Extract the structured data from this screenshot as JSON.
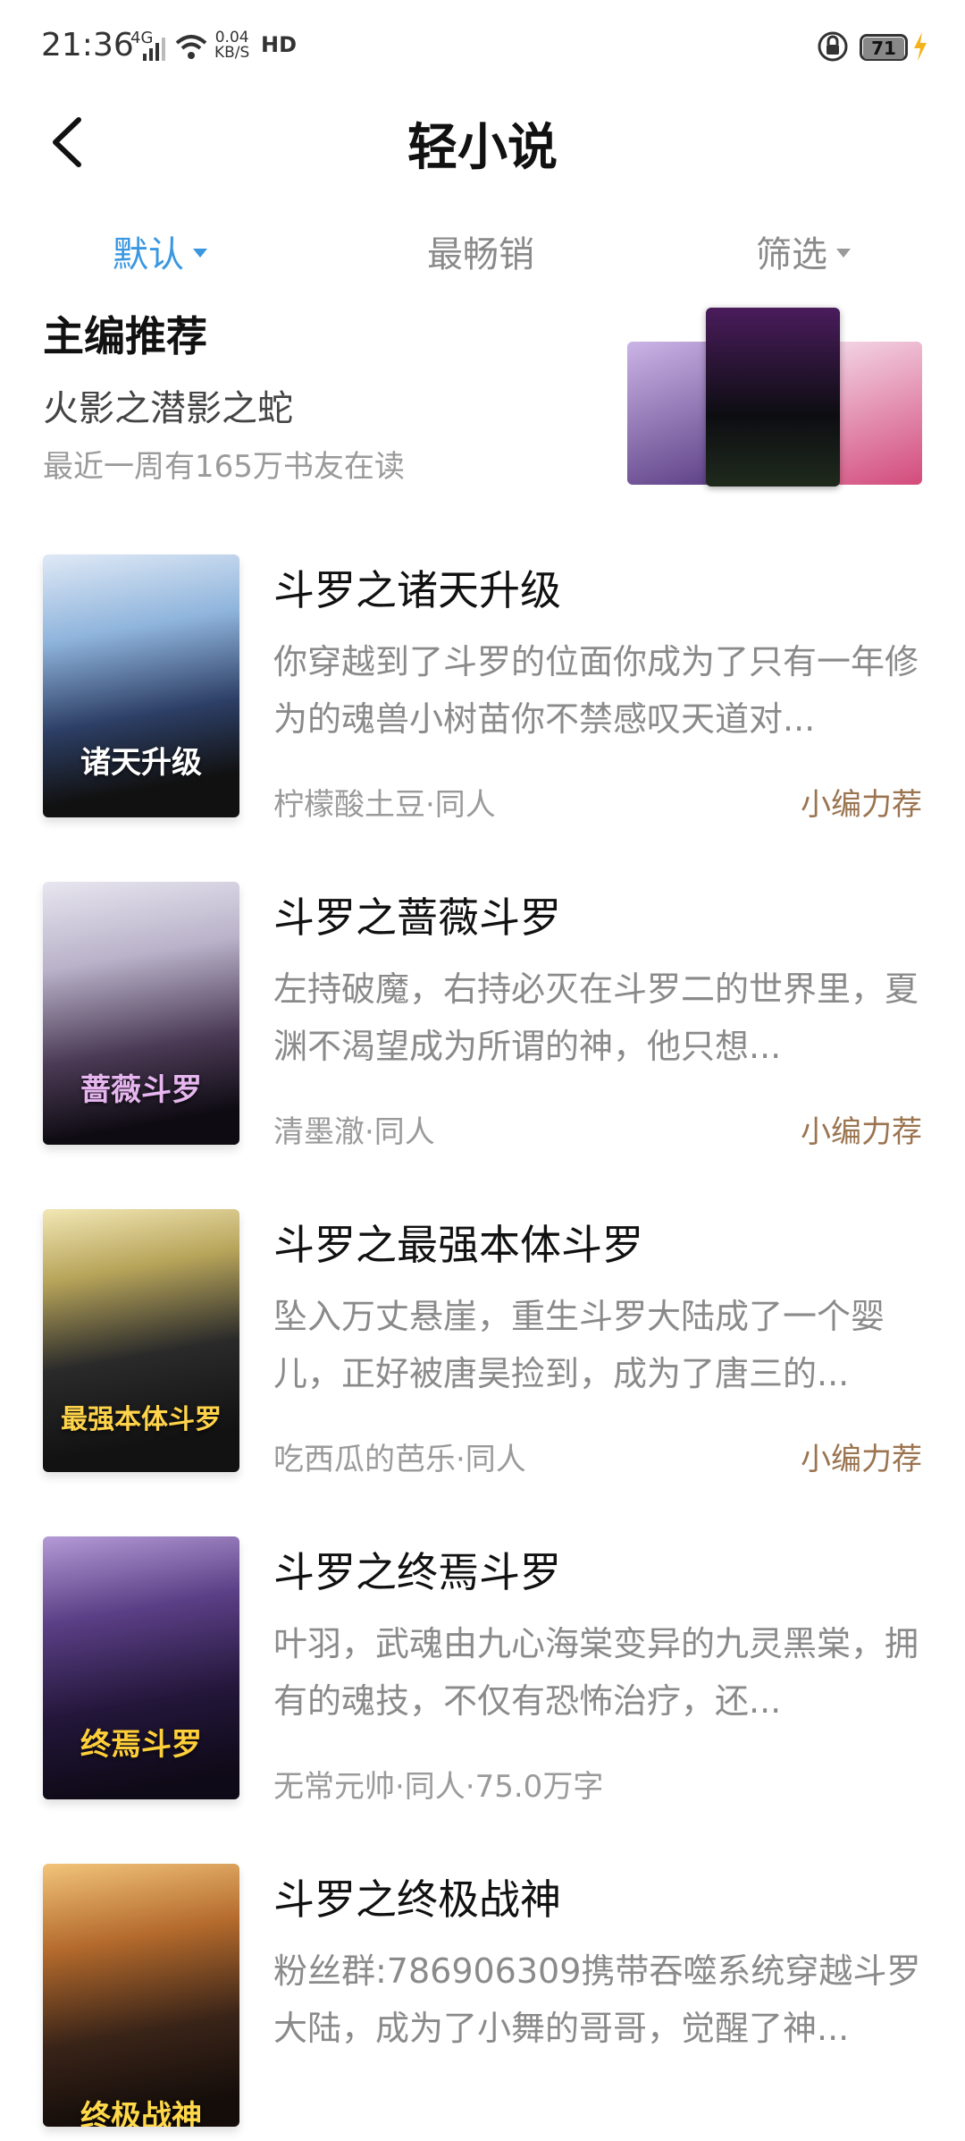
{
  "status_bar": {
    "time": "21:36",
    "network": "4G",
    "speed_top": "0.04",
    "speed_bottom": "KB/S",
    "hd": "HD",
    "battery": "71"
  },
  "header": {
    "title": "轻小说"
  },
  "tabs": [
    {
      "label": "默认",
      "active": true
    },
    {
      "label": "最畅销",
      "active": false
    },
    {
      "label": "筛选",
      "active": false
    }
  ],
  "editor_pick": {
    "heading": "主编推荐",
    "book": "火影之潜影之蛇",
    "readers": "最近一周有165万书友在读"
  },
  "books": [
    {
      "title": "斗罗之诸天升级",
      "desc": "你穿越到了斗罗的位面你成为了只有一年修为的魂兽小树苗你不禁感叹天道对...",
      "meta": "柠檬酸土豆·同人",
      "badge": "小编力荐",
      "cover_text": "诸天升级"
    },
    {
      "title": "斗罗之蔷薇斗罗",
      "desc": "左持破魔，右持必灭在斗罗二的世界里，夏渊不渴望成为所谓的神，他只想...",
      "meta": "清墨澈·同人",
      "badge": "小编力荐",
      "cover_text": "蔷薇斗罗"
    },
    {
      "title": "斗罗之最强本体斗罗",
      "desc": "坠入万丈悬崖，重生斗罗大陆成了一个婴儿，正好被唐昊捡到，成为了唐三的...",
      "meta": "吃西瓜的芭乐·同人",
      "badge": "小编力荐",
      "cover_text": "最强本体斗罗"
    },
    {
      "title": "斗罗之终焉斗罗",
      "desc": "叶羽，武魂由九心海棠变异的九灵黑棠，拥有的魂技，不仅有恐怖治疗，还...",
      "meta": "无常元帅·同人·75.0万字",
      "badge": "",
      "cover_text": "终焉斗罗"
    },
    {
      "title": "斗罗之终极战神",
      "desc": "粉丝群:786906309携带吞噬系统穿越斗罗大陆，成为了小舞的哥哥，觉醒了神...",
      "meta": "",
      "badge": "",
      "cover_text": "终极战神"
    }
  ],
  "colors": {
    "accent": "#3a97e0",
    "badge": "#9b7450",
    "muted": "#8a8a8a"
  }
}
